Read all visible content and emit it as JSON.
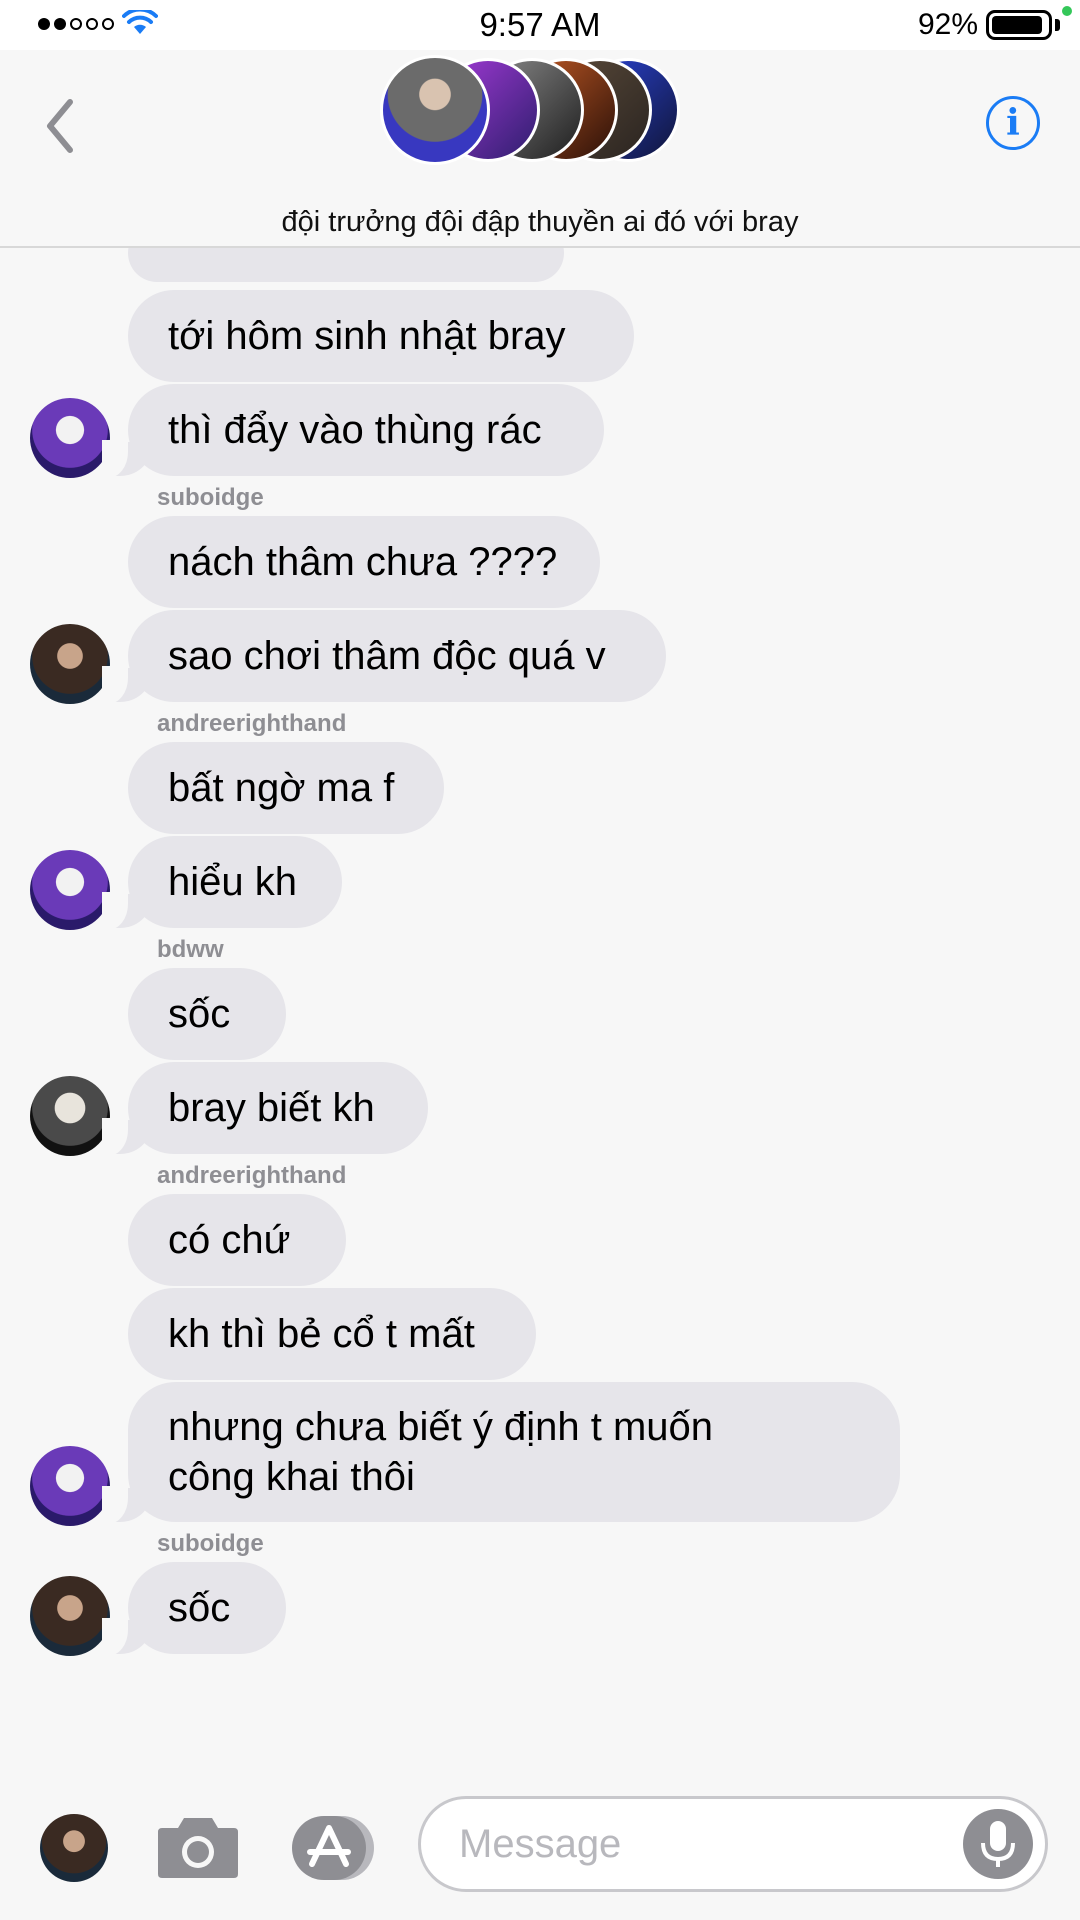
{
  "status_bar": {
    "time": "9:57 AM",
    "battery_percent": "92%",
    "battery_level": 0.92,
    "signal_bars": 2,
    "signal_total": 5
  },
  "header": {
    "title": "đội trưởng đội đập thuyền ai đó với bray",
    "back_icon": "chevron-left-icon",
    "info_label": "i"
  },
  "messages": [
    {
      "text": "",
      "partial": true
    },
    {
      "text": "tới hôm sinh nhật bray"
    },
    {
      "text": "thì đẩy vào thùng rác"
    },
    {
      "sender": "suboidge"
    },
    {
      "text": "nách thâm chưa ????"
    },
    {
      "text": "sao chơi thâm độc quá v"
    },
    {
      "sender": "andreerighthand"
    },
    {
      "text": "bất ngờ ma f"
    },
    {
      "text": "hiểu kh"
    },
    {
      "sender": "bdww"
    },
    {
      "text": "sốc"
    },
    {
      "text": "bray biết kh"
    },
    {
      "sender": "andreerighthand"
    },
    {
      "text": "có chứ"
    },
    {
      "text": "kh thì bẻ cổ t mất"
    },
    {
      "text": "nhưng chưa biết ý định t muốn công khai thôi"
    },
    {
      "sender": "suboidge"
    },
    {
      "text": "sốc"
    }
  ],
  "compose": {
    "placeholder": "Message",
    "camera_icon": "camera-icon",
    "apps_icon": "app-store-icon",
    "mic_icon": "microphone-icon"
  },
  "colors": {
    "bubble": "#e6e5ea",
    "background": "#f7f7f7",
    "accent": "#1a7cf5",
    "sender_label": "#8e8e93"
  }
}
